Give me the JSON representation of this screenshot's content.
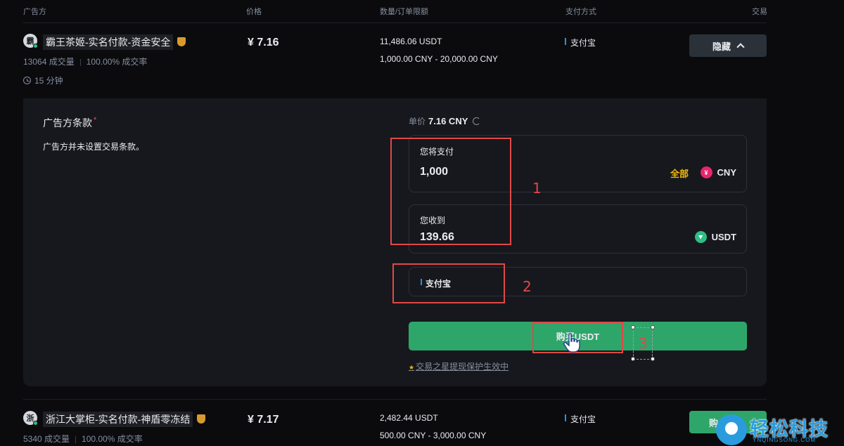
{
  "header": {
    "advertiser": "广告方",
    "price": "价格",
    "quantity": "数量/订单限额",
    "payment": "支付方式",
    "trade": "交易"
  },
  "listing1": {
    "avatar_letter": "霸",
    "name": "霸王茶姬-实名付款-资金安全",
    "trades": "13064 成交量",
    "completion": "100.00% 成交率",
    "time": "15 分钟",
    "price": "¥ 7.16",
    "available": "11,486.06 USDT",
    "limit": "1,000.00 CNY - 20,000.00 CNY",
    "payment": "支付宝",
    "hide_label": "隐藏"
  },
  "panel": {
    "terms_title": "广告方条款",
    "terms_required": "*",
    "terms_text": "广告方并未设置交易条款。",
    "unit_price_label": "单价",
    "unit_price_value": "7.16 CNY",
    "pay_label": "您将支付",
    "pay_value": "1,000",
    "all_label": "全部",
    "pay_currency": "CNY",
    "cny_icon_glyph": "¥",
    "receive_label": "您收到",
    "receive_value": "139.66",
    "receive_currency": "USDT",
    "payment_method": "支付宝",
    "buy_label": "购买USDT",
    "notice": "交易之星提现保护生效中"
  },
  "annotations": {
    "n1": "1",
    "n2": "2",
    "n3": "3",
    "color": "#e04848"
  },
  "listing2": {
    "avatar_letter": "浙",
    "name": "浙江大掌柜-实名付款-神盾零冻结",
    "trades": "5340 成交量",
    "completion": "100.00% 成交率",
    "price": "¥ 7.17",
    "available": "2,482.44 USDT",
    "limit": "500.00 CNY - 3,000.00 CNY",
    "payment": "支付宝",
    "buy_label": "购"
  },
  "watermark": {
    "text": "轻松科技",
    "sub": "YNQINGSONG.COM"
  },
  "colors": {
    "background": "#0b0b0e",
    "panel": "#17181d",
    "buy_green": "#2ea66a",
    "accent_yellow": "#f0b90b",
    "alipay_blue": "#1d95e6"
  }
}
